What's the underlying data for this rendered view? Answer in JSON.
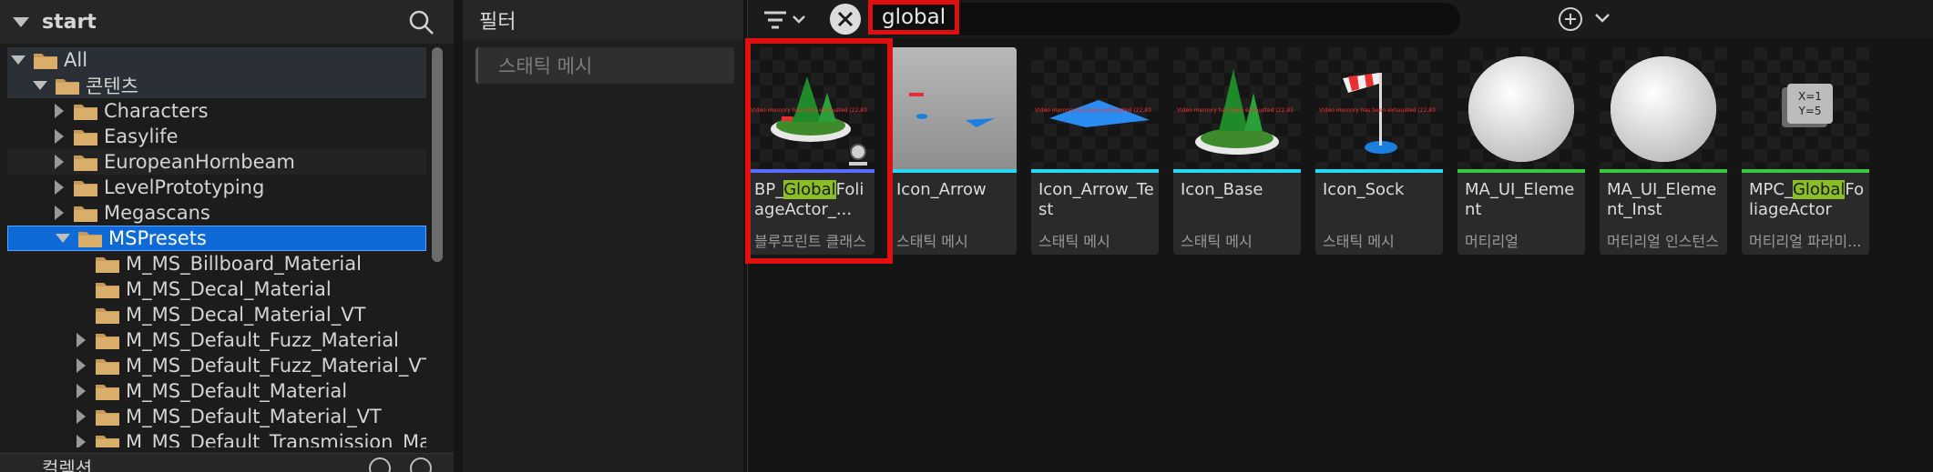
{
  "tree": {
    "title": "start",
    "items": [
      {
        "label": "All",
        "level": 0,
        "state": "expanded"
      },
      {
        "label": "콘텐츠",
        "level": 1,
        "state": "expanded"
      },
      {
        "label": "Characters",
        "level": 2,
        "state": "collapsed"
      },
      {
        "label": "Easylife",
        "level": 2,
        "state": "collapsed"
      },
      {
        "label": "EuropeanHornbeam",
        "level": 2,
        "state": "collapsed"
      },
      {
        "label": "LevelPrototyping",
        "level": 2,
        "state": "collapsed"
      },
      {
        "label": "Megascans",
        "level": 2,
        "state": "collapsed"
      },
      {
        "label": "MSPresets",
        "level": 2,
        "state": "expanded",
        "selected": true
      },
      {
        "label": "M_MS_Billboard_Material",
        "level": 3,
        "state": "leaf"
      },
      {
        "label": "M_MS_Decal_Material",
        "level": 3,
        "state": "leaf"
      },
      {
        "label": "M_MS_Decal_Material_VT",
        "level": 3,
        "state": "leaf"
      },
      {
        "label": "M_MS_Default_Fuzz_Material",
        "level": 3,
        "state": "collapsed"
      },
      {
        "label": "M_MS_Default_Fuzz_Material_VT",
        "level": 3,
        "state": "collapsed"
      },
      {
        "label": "M_MS_Default_Material",
        "level": 3,
        "state": "collapsed"
      },
      {
        "label": "M_MS_Default_Material_VT",
        "level": 3,
        "state": "collapsed"
      },
      {
        "label": "M_MS_Default_Transmission_Mat",
        "level": 3,
        "state": "collapsed"
      }
    ],
    "bottom_label": "컬렉션"
  },
  "filters": {
    "title": "필터",
    "chip": "스태틱 메시"
  },
  "search": {
    "query": "global"
  },
  "assets": [
    {
      "name_pre": "BP_",
      "name_hl": "Global",
      "name_post": "FoliageActor_...",
      "type": "블루프린트 클래스",
      "strip": "#5a6cff",
      "thumb": "foliage-blueprint"
    },
    {
      "name_pre": "Icon_Arrow",
      "name_hl": "",
      "name_post": "",
      "type": "스태틱 메시",
      "strip": "#28d8f0",
      "thumb": "arrow"
    },
    {
      "name_pre": "Icon_Arrow_Test",
      "name_hl": "",
      "name_post": "",
      "type": "스태틱 메시",
      "strip": "#28d8f0",
      "thumb": "arrow-test"
    },
    {
      "name_pre": "Icon_Base",
      "name_hl": "",
      "name_post": "",
      "type": "스태틱 메시",
      "strip": "#28d8f0",
      "thumb": "base"
    },
    {
      "name_pre": "Icon_Sock",
      "name_hl": "",
      "name_post": "",
      "type": "스태틱 메시",
      "strip": "#28d8f0",
      "thumb": "sock"
    },
    {
      "name_pre": "MA_UI_Element",
      "name_hl": "",
      "name_post": "",
      "type": "머티리얼",
      "strip": "#3cc83c",
      "thumb": "sphere"
    },
    {
      "name_pre": "MA_UI_Element_Inst",
      "name_hl": "",
      "name_post": "",
      "type": "머티리얼 인스턴스",
      "strip": "#3cc83c",
      "thumb": "sphere"
    },
    {
      "name_pre": "MPC_",
      "name_hl": "Global",
      "name_post": "FoliageActor",
      "type": "머티리얼 파라미...",
      "strip": "#3cc83c",
      "thumb": "mpc"
    }
  ],
  "thumb_warning": "Video memory has been exhausted (22.83",
  "mpc_icon": {
    "line1": "X=1",
    "line2": "Y=5"
  },
  "colors": {
    "selection": "#0e6ad6",
    "highlight": "#8bbd28",
    "annotation_red": "#e01010"
  }
}
